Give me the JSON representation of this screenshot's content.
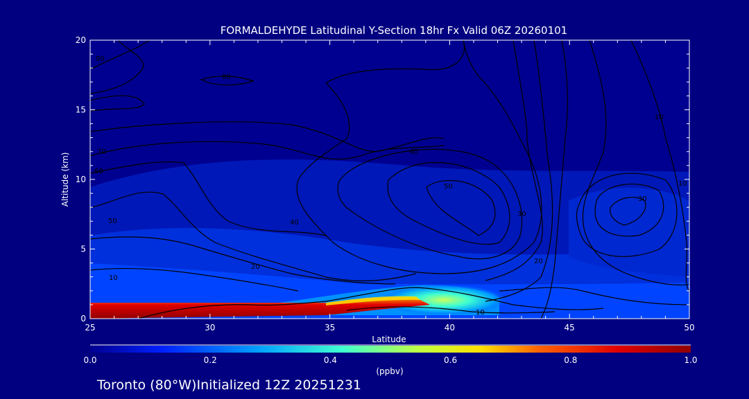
{
  "chart_data": {
    "type": "heatmap",
    "title": "FORMALDEHYDE Latitudinal Y-Section 18hr  Fx Valid 06Z 20260101",
    "xlabel": "Latitude",
    "ylabel": "Altitude (km)",
    "xlim": [
      25,
      50
    ],
    "ylim": [
      0,
      20
    ],
    "x_ticks": [
      "25",
      "30",
      "35",
      "40",
      "45",
      "50"
    ],
    "y_ticks": [
      "0",
      "5",
      "10",
      "15",
      "20"
    ],
    "colorbar": {
      "label": "(ppbv)",
      "range": [
        0.0,
        1.0
      ],
      "ticks": [
        "0.0",
        "0.2",
        "0.4",
        "0.6",
        "0.8",
        "1.0"
      ],
      "colors": [
        "#000090",
        "#0020ff",
        "#00a0ff",
        "#40ffd0",
        "#c0ff40",
        "#ffe000",
        "#ff6000",
        "#e00000",
        "#900000"
      ]
    },
    "contour_labels": [
      "10",
      "20",
      "30",
      "40",
      "50",
      "60",
      "70",
      "80",
      "90"
    ],
    "grid": false,
    "legend": "colorbar-bottom"
  },
  "footer": {
    "location": "Toronto (80°W)Initialized 12Z 20251231"
  }
}
